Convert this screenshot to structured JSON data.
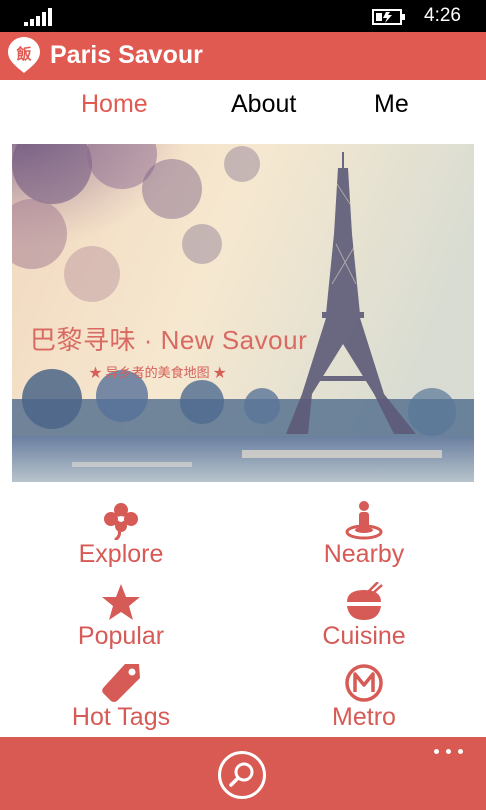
{
  "status_bar": {
    "time": "4:26",
    "signal_icon": "signal-strength-icon",
    "battery_icon": "battery-charging-icon"
  },
  "app": {
    "title": "Paris Savour",
    "logo_icon": "paris-savour-logo-icon"
  },
  "tabs": [
    {
      "label": "Home",
      "active": true
    },
    {
      "label": "About",
      "active": false
    },
    {
      "label": "Me",
      "active": false
    }
  ],
  "hero": {
    "title": "巴黎寻味 · New Savour",
    "subtitle": "★ 异乡者的美食地图 ★"
  },
  "menu": [
    {
      "label": "Explore",
      "icon": "clover-icon"
    },
    {
      "label": "Nearby",
      "icon": "person-location-icon"
    },
    {
      "label": "Popular",
      "icon": "star-icon"
    },
    {
      "label": "Cuisine",
      "icon": "rice-bowl-chopsticks-icon"
    },
    {
      "label": "Hot Tags",
      "icon": "tag-icon"
    },
    {
      "label": "Metro",
      "icon": "metro-icon"
    }
  ],
  "bottom_bar": {
    "search_icon": "search-icon",
    "more_icon": "more-icon"
  },
  "colors": {
    "accent": "#e05a52",
    "bottom_bar": "#d85a52",
    "status_bar": "#000000"
  }
}
